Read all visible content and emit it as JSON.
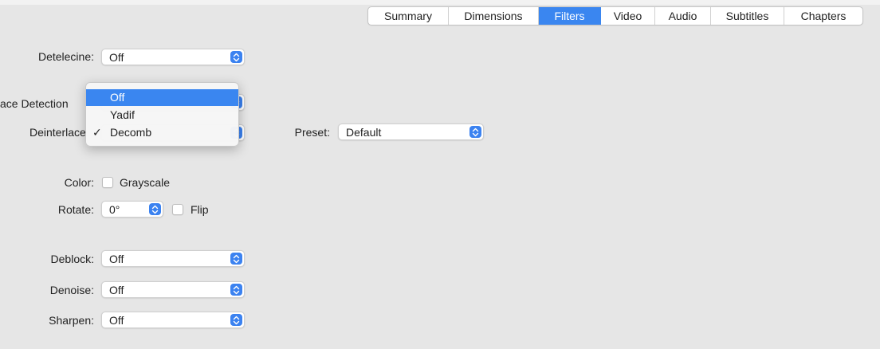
{
  "tabs": [
    {
      "label": "Summary",
      "active": false
    },
    {
      "label": "Dimensions",
      "active": false
    },
    {
      "label": "Filters",
      "active": true
    },
    {
      "label": "Video",
      "active": false
    },
    {
      "label": "Audio",
      "active": false
    },
    {
      "label": "Subtitles",
      "active": false
    },
    {
      "label": "Chapters",
      "active": false
    }
  ],
  "detelecine": {
    "label": "Detelecine:",
    "value": "Off"
  },
  "interlace_detection": {
    "label": "ace Detection"
  },
  "deinterlace": {
    "label": "Deinterlace"
  },
  "preset": {
    "label": "Preset:",
    "value": "Default"
  },
  "dropdown": {
    "items": [
      {
        "label": "Off",
        "highlighted": true,
        "checked": false
      },
      {
        "label": "Yadif",
        "highlighted": false,
        "checked": false
      },
      {
        "label": "Decomb",
        "highlighted": false,
        "checked": true
      }
    ],
    "check_glyph": "✓"
  },
  "color": {
    "label": "Color:",
    "checkbox_label": "Grayscale",
    "checked": false
  },
  "rotate": {
    "label": "Rotate:",
    "value": "0°",
    "flip_label": "Flip",
    "flip_checked": false
  },
  "deblock": {
    "label": "Deblock:",
    "value": "Off"
  },
  "denoise": {
    "label": "Denoise:",
    "value": "Off"
  },
  "sharpen": {
    "label": "Sharpen:",
    "value": "Off"
  },
  "accent_color": "#3a86f0"
}
